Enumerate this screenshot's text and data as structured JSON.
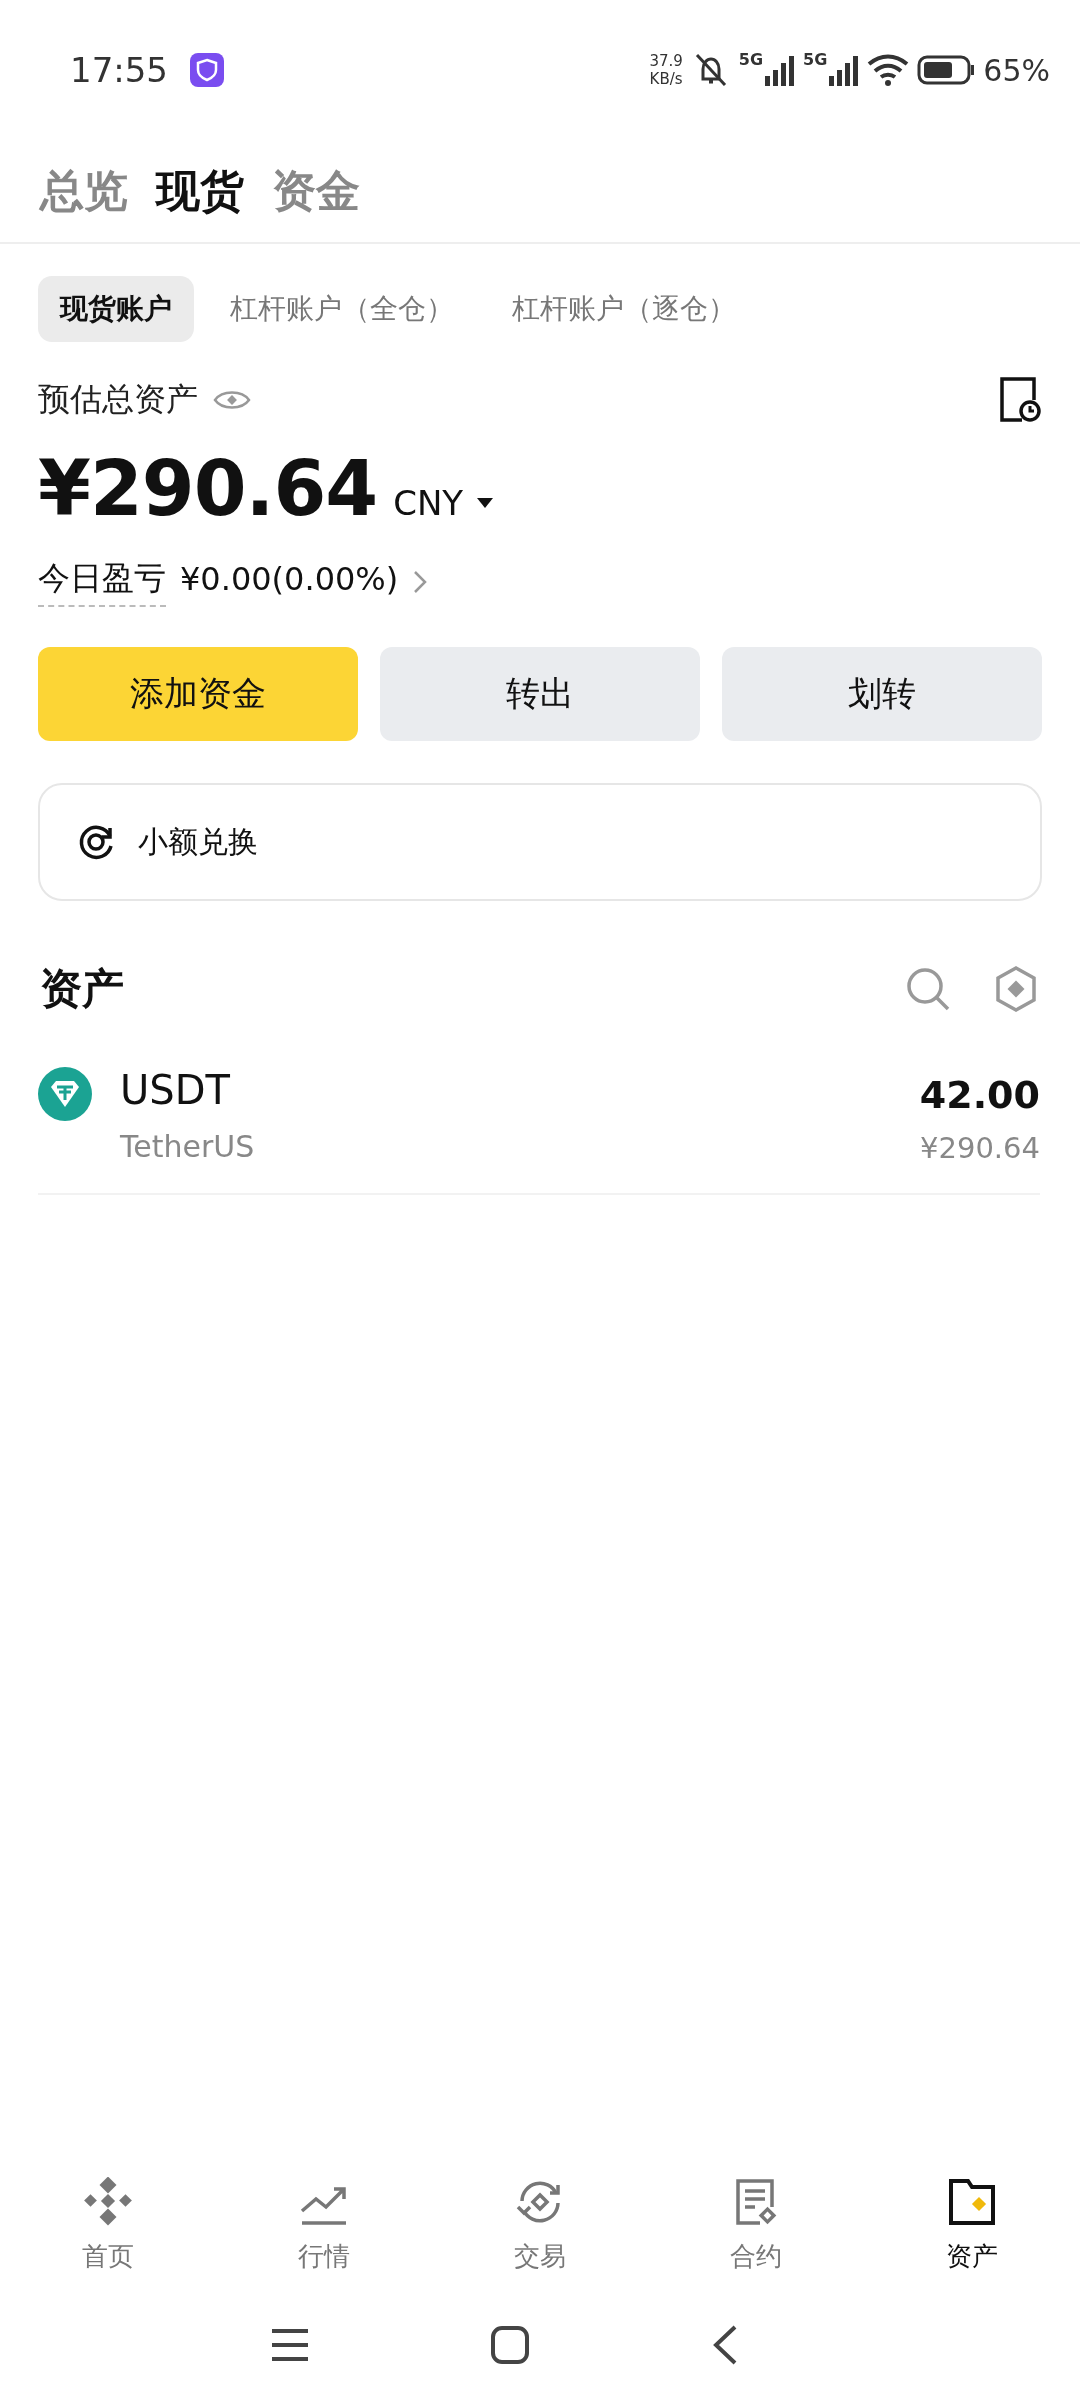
{
  "status_bar": {
    "time": "17:55",
    "net_speed": "37.9",
    "net_unit": "KB/s",
    "sim1": "5G",
    "sim2": "5G",
    "battery": "65%"
  },
  "top_tabs": [
    {
      "label": "总览",
      "selected": false
    },
    {
      "label": "现货",
      "selected": true
    },
    {
      "label": "资金",
      "selected": false
    }
  ],
  "account_tabs": [
    {
      "label": "现货账户",
      "selected": true
    },
    {
      "label": "杠杆账户（全仓）",
      "selected": false
    },
    {
      "label": "杠杆账户（逐仓）",
      "selected": false
    }
  ],
  "balance": {
    "label": "预估总资产",
    "amount": "¥290.64",
    "currency": "CNY",
    "pnl_label": "今日盈亏",
    "pnl_value": "¥0.00(0.00%)"
  },
  "actions": [
    {
      "label": "添加资金",
      "kind": "primary"
    },
    {
      "label": "转出",
      "kind": "secondary"
    },
    {
      "label": "划转",
      "kind": "secondary"
    }
  ],
  "small_exchange": "小额兑换",
  "assets": {
    "title": "资产",
    "rows": [
      {
        "symbol": "USDT",
        "name": "TetherUS",
        "amount": "42.00",
        "value": "¥290.64"
      }
    ]
  },
  "bottom_nav": [
    {
      "label": "首页",
      "selected": false
    },
    {
      "label": "行情",
      "selected": false
    },
    {
      "label": "交易",
      "selected": false
    },
    {
      "label": "合约",
      "selected": false
    },
    {
      "label": "资产",
      "selected": true
    }
  ]
}
